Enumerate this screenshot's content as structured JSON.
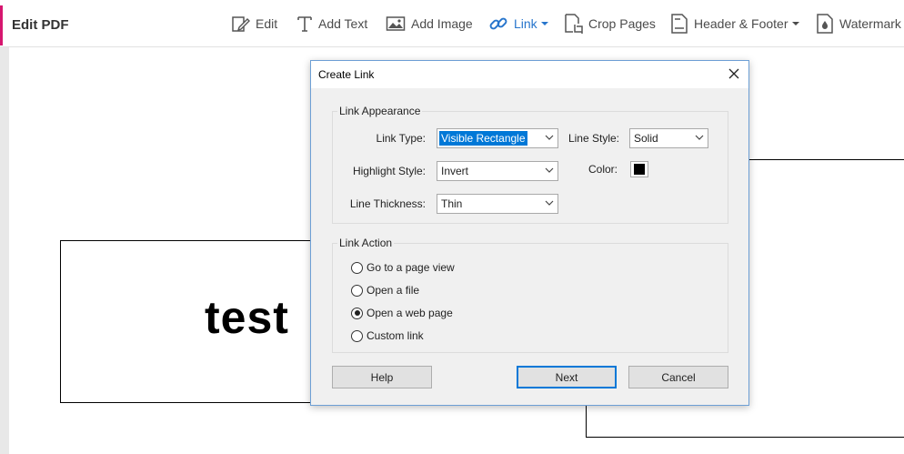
{
  "toolbar": {
    "title": "Edit PDF",
    "accent_color": "#d6166f",
    "active_color": "#2775cc",
    "tools": {
      "edit": {
        "label": "Edit",
        "icon": "edit-icon"
      },
      "add_text": {
        "label": "Add Text",
        "icon": "text-icon"
      },
      "add_image": {
        "label": "Add Image",
        "icon": "image-icon"
      },
      "link": {
        "label": "Link",
        "icon": "link-icon",
        "active": true
      },
      "crop_pages": {
        "label": "Crop Pages",
        "icon": "crop-icon"
      },
      "header_footer": {
        "label": "Header & Footer",
        "icon": "page-icon"
      },
      "watermark": {
        "label": "Watermark",
        "icon": "watermark-icon"
      }
    }
  },
  "document": {
    "text": "test"
  },
  "dialog": {
    "title": "Create Link",
    "appearance": {
      "group_label": "Link Appearance",
      "link_type_label": "Link Type:",
      "link_type_value": "Visible Rectangle",
      "line_style_label": "Line Style:",
      "line_style_value": "Solid",
      "highlight_style_label": "Highlight Style:",
      "highlight_style_value": "Invert",
      "color_label": "Color:",
      "color_value": "#000000",
      "line_thickness_label": "Line Thickness:",
      "line_thickness_value": "Thin"
    },
    "action": {
      "group_label": "Link Action",
      "options": [
        {
          "label": "Go to a page view",
          "checked": false
        },
        {
          "label": "Open a file",
          "checked": false
        },
        {
          "label": "Open a web page",
          "checked": true
        },
        {
          "label": "Custom link",
          "checked": false
        }
      ]
    },
    "buttons": {
      "help": "Help",
      "next": "Next",
      "cancel": "Cancel"
    }
  }
}
